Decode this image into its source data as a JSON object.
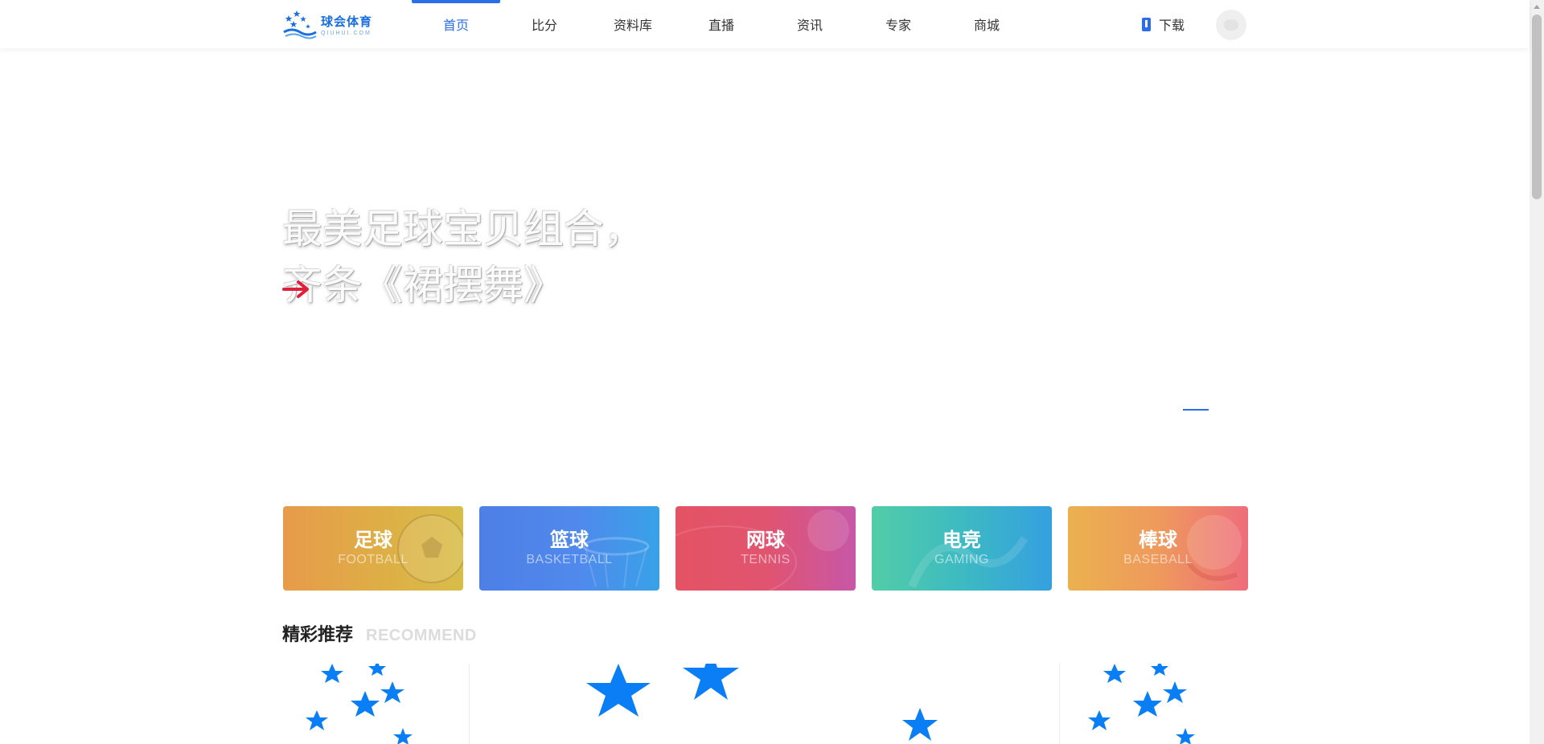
{
  "header": {
    "logo": {
      "cn": "球会体育",
      "en": "QIUHUI.COM"
    },
    "nav": [
      {
        "label": "首页",
        "active": true
      },
      {
        "label": "比分",
        "active": false
      },
      {
        "label": "资料库",
        "active": false
      },
      {
        "label": "直播",
        "active": false
      },
      {
        "label": "资讯",
        "active": false
      },
      {
        "label": "专家",
        "active": false
      },
      {
        "label": "商城",
        "active": false
      }
    ],
    "download_label": "下载"
  },
  "hero": {
    "title_line1": "最美足球宝贝组合，",
    "title_line2": "齐条《裙摆舞》",
    "arrow_color": "#e0203a"
  },
  "sports": [
    {
      "cn": "足球",
      "en": "FOOTBALL"
    },
    {
      "cn": "篮球",
      "en": "BASKETBALL"
    },
    {
      "cn": "网球",
      "en": "TENNIS"
    },
    {
      "cn": "电竞",
      "en": "GAMING"
    },
    {
      "cn": "棒球",
      "en": "BASEBALL"
    }
  ],
  "recommend": {
    "title_cn": "精彩推荐",
    "title_en": "RECOMMEND"
  },
  "colors": {
    "accent": "#2b6fe8",
    "star_blue": "#0a7ff5"
  }
}
